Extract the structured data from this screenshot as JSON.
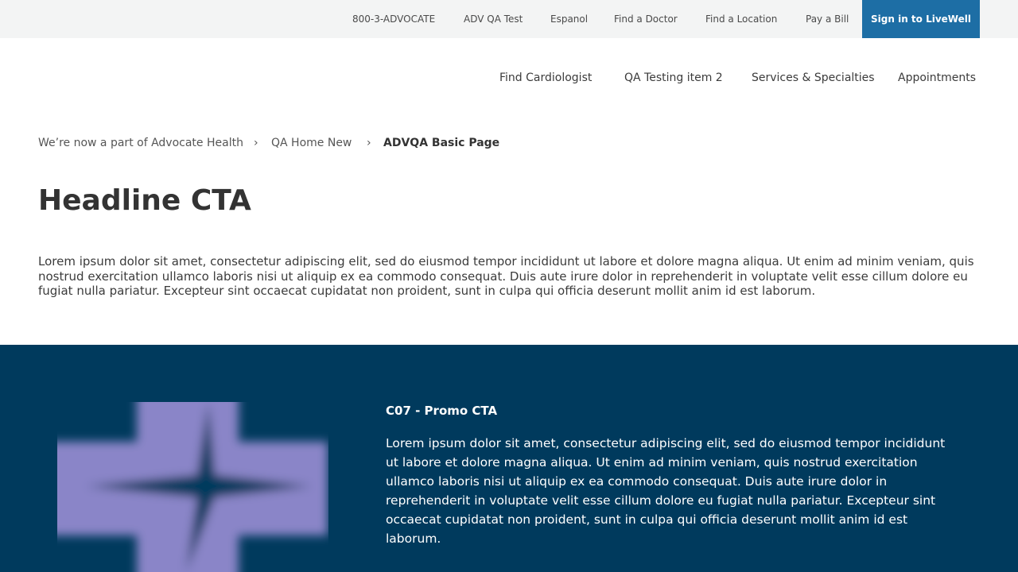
{
  "utility_nav": {
    "phone": "800-3-ADVOCATE",
    "qa_test": "ADV QA Test",
    "espanol": "Espanol",
    "find_doctor": "Find a Doctor",
    "find_location": "Find a Location",
    "pay_bill": "Pay a Bill",
    "sign_in": "Sign in to LiveWell"
  },
  "main_nav": {
    "items": [
      "Find Cardiologist",
      "QA Testing item 2",
      "Services & Specialties",
      "Appointments"
    ]
  },
  "breadcrumb": {
    "items": [
      "We’re now a part of Advocate Health",
      "QA Home New"
    ],
    "separator": "›",
    "current": "ADVQA Basic Page"
  },
  "page": {
    "headline": "Headline CTA",
    "intro": "Lorem ipsum dolor sit amet, consectetur adipiscing elit, sed do eiusmod tempor incididunt ut labore et dolore magna aliqua. Ut enim ad minim veniam, quis nostrud exercitation ullamco laboris nisi ut aliquip ex ea commodo consequat. Duis aute irure dolor in reprehenderit in voluptate velit esse cillum dolore eu fugiat nulla pariatur. Excepteur sint occaecat cupidatat non proident, sunt in culpa qui officia deserunt mollit anim id est laborum."
  },
  "promo": {
    "title": "C07 - Promo CTA",
    "body": "Lorem ipsum dolor sit amet, consectetur adipiscing elit, sed do eiusmod tempor incididunt ut labore et dolore magna aliqua. Ut enim ad minim veniam, quis nostrud exercitation ullamco laboris nisi ut aliquip ex ea commodo consequat. Duis aute irure dolor in reprehenderit in voluptate velit esse cillum dolore eu fugiat nulla pariatur. Excepteur sint occaecat cupidatat non proident, sunt in culpa qui officia deserunt mollit anim id est laborum.",
    "image_icon": "advocate-cross-logo-icon"
  },
  "colors": {
    "utility_bg": "#f3f4f4",
    "sign_in_bg": "#1d6ea5",
    "promo_bg": "#003a5d",
    "logo_cross": "#8a85c8"
  }
}
